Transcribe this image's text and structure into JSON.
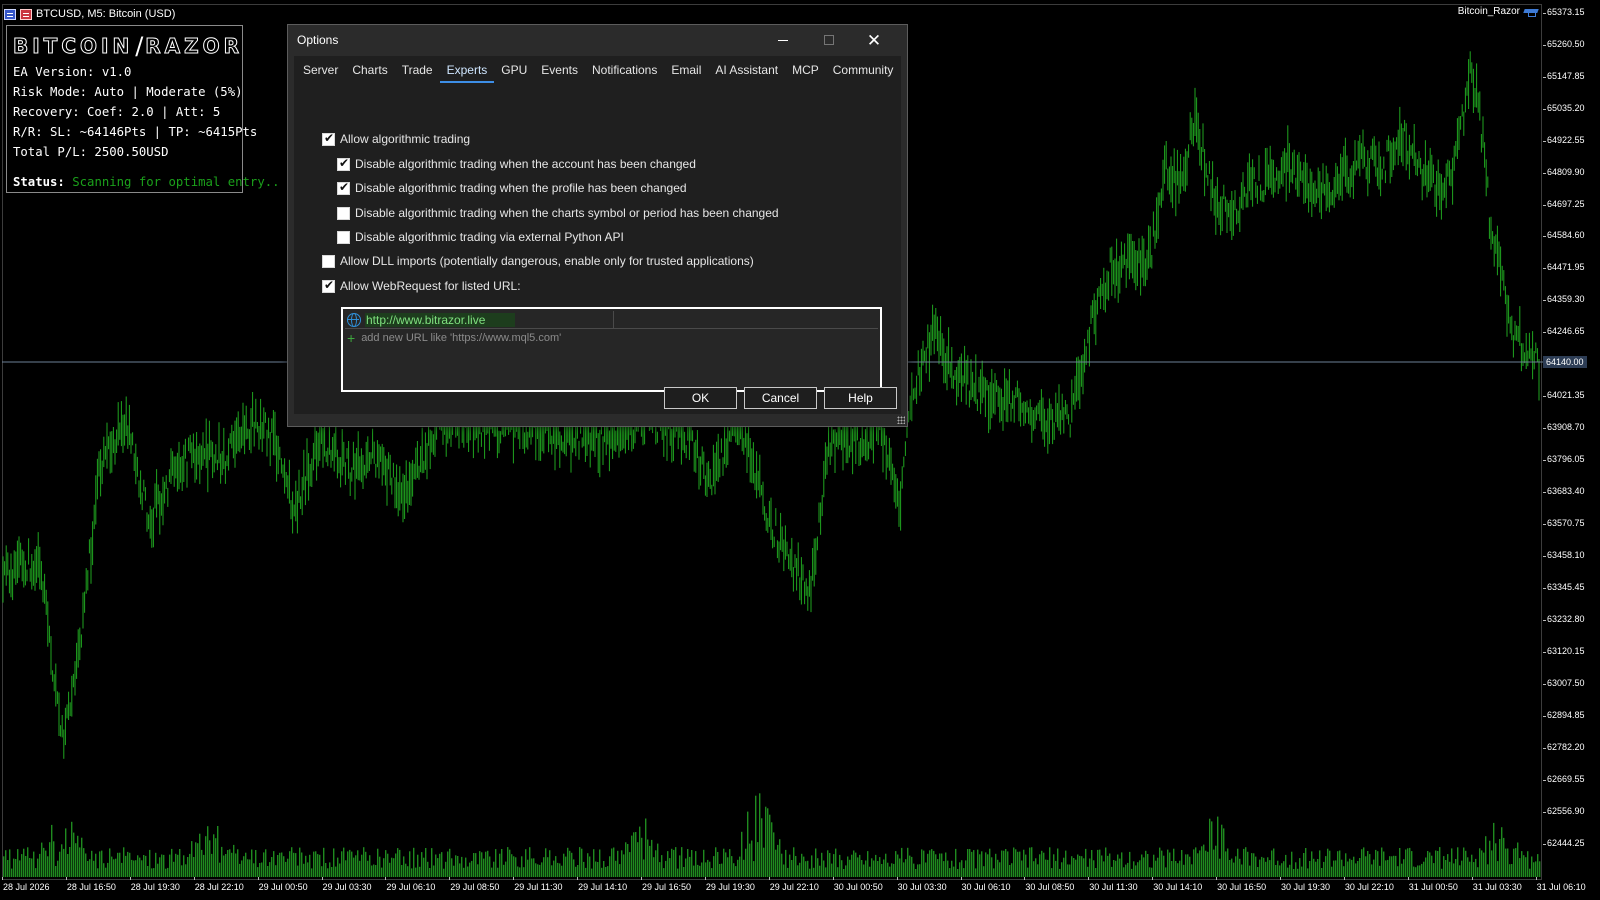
{
  "window": {
    "title": "BTCUSD, M5:  Bitcoin (USD)",
    "ea_tag": "Bitcoin_Razor"
  },
  "ea_panel": {
    "logo_left": "BITCOIN",
    "logo_right": "RAZOR",
    "lines": [
      "EA Version: v1.0",
      "Risk Mode: Auto | Moderate (5%)",
      "Recovery: Coef: 2.0 | Att: 5",
      "R/R: SL: ~64146Pts | TP: ~6415Pts",
      "Total P/L: 2500.50USD"
    ],
    "status_label": "Status:",
    "status_value": "Scanning for optimal entry..",
    "status_color": "#1ba01b"
  },
  "price_axis": {
    "labels": [
      "65373.15",
      "65260.50",
      "65147.85",
      "65035.20",
      "64922.55",
      "64809.90",
      "64697.25",
      "64584.60",
      "64471.95",
      "64359.30",
      "64246.65",
      "64021.35",
      "63908.70",
      "63796.05",
      "63683.40",
      "63570.75",
      "63458.10",
      "63345.45",
      "63232.80",
      "63120.15",
      "63007.50",
      "62894.85",
      "62782.20",
      "62669.55",
      "62556.90",
      "62444.25"
    ],
    "current": "64140.00"
  },
  "time_axis": {
    "labels": [
      "28 Jul 2026",
      "28 Jul 16:50",
      "28 Jul 19:30",
      "28 Jul 22:10",
      "29 Jul 00:50",
      "29 Jul 03:30",
      "29 Jul 06:10",
      "29 Jul 08:50",
      "29 Jul 11:30",
      "29 Jul 14:10",
      "29 Jul 16:50",
      "29 Jul 19:30",
      "29 Jul 22:10",
      "30 Jul 00:50",
      "30 Jul 03:30",
      "30 Jul 06:10",
      "30 Jul 08:50",
      "30 Jul 11:30",
      "30 Jul 14:10",
      "30 Jul 16:50",
      "30 Jul 19:30",
      "30 Jul 22:10",
      "31 Jul 00:50",
      "31 Jul 03:30",
      "31 Jul 06:10"
    ]
  },
  "chart": {
    "bar_color": "#1fa51f",
    "volume_color": "#1f8a1f",
    "current_line_color": "#6c7f96",
    "y_range": [
      62444.25,
      65373.15
    ]
  },
  "dialog": {
    "title": "Options",
    "tabs": [
      "Server",
      "Charts",
      "Trade",
      "Experts",
      "GPU",
      "Events",
      "Notifications",
      "Email",
      "AI Assistant",
      "MCP",
      "Community"
    ],
    "active_tab": "Experts",
    "options": [
      {
        "label": "Allow algorithmic trading",
        "checked": true
      },
      {
        "label": "Disable algorithmic trading when the account has been changed",
        "checked": true
      },
      {
        "label": "Disable algorithmic trading when the profile has been changed",
        "checked": true
      },
      {
        "label": "Disable algorithmic trading when the charts symbol or period has been changed",
        "checked": false
      },
      {
        "label": "Disable algorithmic trading via external Python API",
        "checked": false
      },
      {
        "label": "Allow DLL imports (potentially dangerous, enable only for trusted applications)",
        "checked": false
      },
      {
        "label": "Allow WebRequest for listed URL:",
        "checked": true
      }
    ],
    "url_list": {
      "urls": [
        "http://www.bitrazor.live"
      ],
      "add_placeholder": "add new URL like 'https://www.mql5.com'"
    },
    "buttons": {
      "ok": "OK",
      "cancel": "Cancel",
      "help": "Help"
    }
  }
}
